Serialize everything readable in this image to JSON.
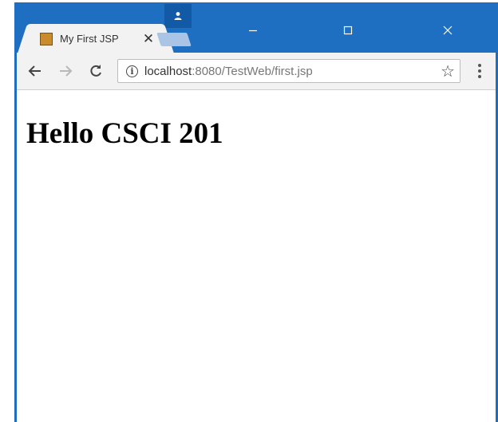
{
  "browser": {
    "tab": {
      "title": "My First JSP",
      "favicon": "java-cup-icon",
      "close_label": "✕"
    },
    "window_controls": {
      "minimize": "—",
      "maximize": "☐",
      "close": "✕"
    },
    "toolbar": {
      "back": "←",
      "forward": "→",
      "reload": "C",
      "url_host": "localhost",
      "url_path": ":8080/TestWeb/first.jsp",
      "info": "i",
      "bookmark": "☆"
    },
    "colors": {
      "titlebar": "#1e6fc2",
      "toolbar": "#f2f2f2"
    }
  },
  "page": {
    "heading": "Hello CSCI 201"
  }
}
